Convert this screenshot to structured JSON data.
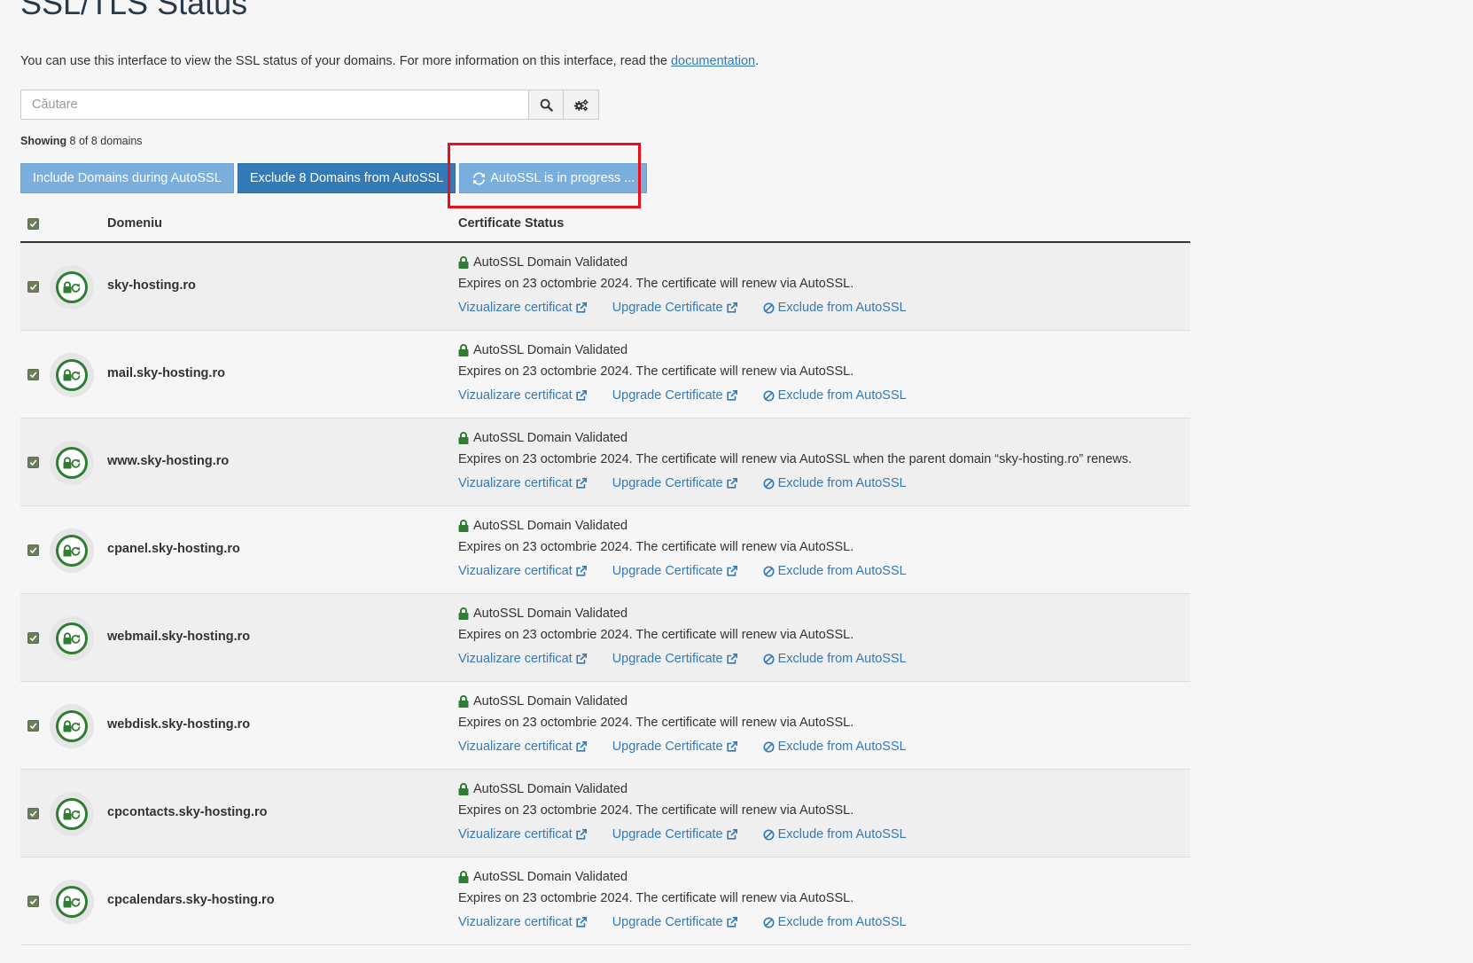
{
  "page": {
    "title": "SSL/TLS Status",
    "intro_text": "You can use this interface to view the SSL status of your domains. For more information on this interface, read the ",
    "intro_link": "documentation",
    "intro_end": "."
  },
  "search": {
    "placeholder": "Căutare"
  },
  "icons": {
    "search": "search-icon",
    "settings": "gears-icon",
    "refresh": "refresh-icon",
    "lock": "lock-icon",
    "external": "external-link-icon",
    "ban": "ban-icon",
    "ssl_badge": "ssl-lock-badge-icon"
  },
  "showing": {
    "label": "Showing",
    "text": " 8 of 8 domains"
  },
  "actions": {
    "include_label": "Include Domains during AutoSSL",
    "exclude_label": "Exclude 8 Domains from AutoSSL",
    "progress_label": "AutoSSL is in progress ..."
  },
  "table": {
    "col_domain": "Domeniu",
    "col_status": "Certificate Status",
    "link_view": "Vizualizare certificat",
    "link_upgrade": "Upgrade Certificate",
    "link_exclude": "Exclude from AutoSSL",
    "rows": [
      {
        "domain": "sky-hosting.ro",
        "status": "AutoSSL Domain Validated",
        "expires": "Expires on 23 octombrie 2024. The certificate will renew via AutoSSL."
      },
      {
        "domain": "mail.sky-hosting.ro",
        "status": "AutoSSL Domain Validated",
        "expires": "Expires on 23 octombrie 2024. The certificate will renew via AutoSSL."
      },
      {
        "domain": "www.sky-hosting.ro",
        "status": "AutoSSL Domain Validated",
        "expires": "Expires on 23 octombrie 2024. The certificate will renew via AutoSSL when the parent domain “sky-hosting.ro” renews."
      },
      {
        "domain": "cpanel.sky-hosting.ro",
        "status": "AutoSSL Domain Validated",
        "expires": "Expires on 23 octombrie 2024. The certificate will renew via AutoSSL."
      },
      {
        "domain": "webmail.sky-hosting.ro",
        "status": "AutoSSL Domain Validated",
        "expires": "Expires on 23 octombrie 2024. The certificate will renew via AutoSSL."
      },
      {
        "domain": "webdisk.sky-hosting.ro",
        "status": "AutoSSL Domain Validated",
        "expires": "Expires on 23 octombrie 2024. The certificate will renew via AutoSSL."
      },
      {
        "domain": "cpcontacts.sky-hosting.ro",
        "status": "AutoSSL Domain Validated",
        "expires": "Expires on 23 octombrie 2024. The certificate will renew via AutoSSL."
      },
      {
        "domain": "cpcalendars.sky-hosting.ro",
        "status": "AutoSSL Domain Validated",
        "expires": "Expires on 23 octombrie 2024. The certificate will renew via AutoSSL."
      }
    ]
  },
  "colors": {
    "link": "#337ab7",
    "primary_button": "#337ab7",
    "light_button": "#7aaedc",
    "lock_green": "#2e7d32",
    "highlight_red": "#e8101c"
  }
}
